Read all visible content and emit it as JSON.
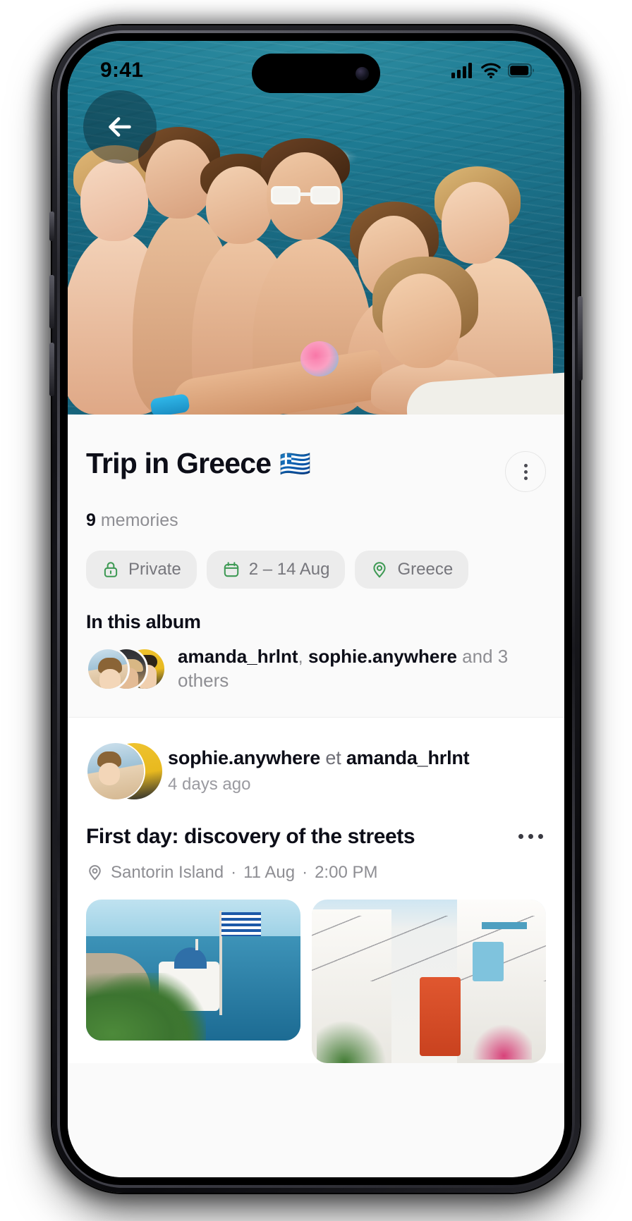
{
  "status_bar": {
    "time": "9:41",
    "icons": [
      "cellular-signal-icon",
      "wifi-icon",
      "battery-icon"
    ]
  },
  "hero": {
    "back_button_icon": "arrow-left-icon",
    "alt": "group selfie of friends swimming in turquoise sea"
  },
  "album": {
    "title": "Trip in Greece",
    "flag_emoji": "🇬🇷",
    "more_button_icon": "more-vertical-icon",
    "memories_count": "9",
    "memories_label": "memories",
    "chips": [
      {
        "icon": "lock-icon",
        "label": "Private"
      },
      {
        "icon": "calendar-icon",
        "label": "2 – 14 Aug"
      },
      {
        "icon": "map-pin-icon",
        "label": "Greece"
      }
    ],
    "section_title": "In this album",
    "members": {
      "name_1": "amanda_hrlnt",
      "separator": ", ",
      "name_2": "sophie.anywhere",
      "suffix": " and 3 others",
      "avatars": [
        "avatar-amanda",
        "avatar-traveler",
        "avatar-sophie"
      ]
    }
  },
  "post": {
    "authors": "sophie.anywhere",
    "authors_conjunction": "et",
    "authors_second": "amanda_hrlnt",
    "timestamp": "4 days ago",
    "title": "First day: discovery of the streets",
    "more_button_icon": "more-horizontal-icon",
    "meta": {
      "location_icon": "map-pin-icon",
      "location": "Santorin Island",
      "dot_1": "·",
      "date": "11 Aug",
      "dot_2": "·",
      "time": "2:00 PM"
    },
    "photos": [
      {
        "name": "photo-santorini-church",
        "alt": "white church with Greek flag over the sea"
      },
      {
        "name": "photo-mykonos-street",
        "alt": "white alley with red door in Mykonos"
      }
    ]
  },
  "colors": {
    "accent_green": "#3f9a55",
    "chip_bg": "#ececec",
    "text_primary": "#0d0e18",
    "text_muted": "#8e8e93",
    "sheet_bg": "#fafafa",
    "card_bg": "#ffffff"
  }
}
